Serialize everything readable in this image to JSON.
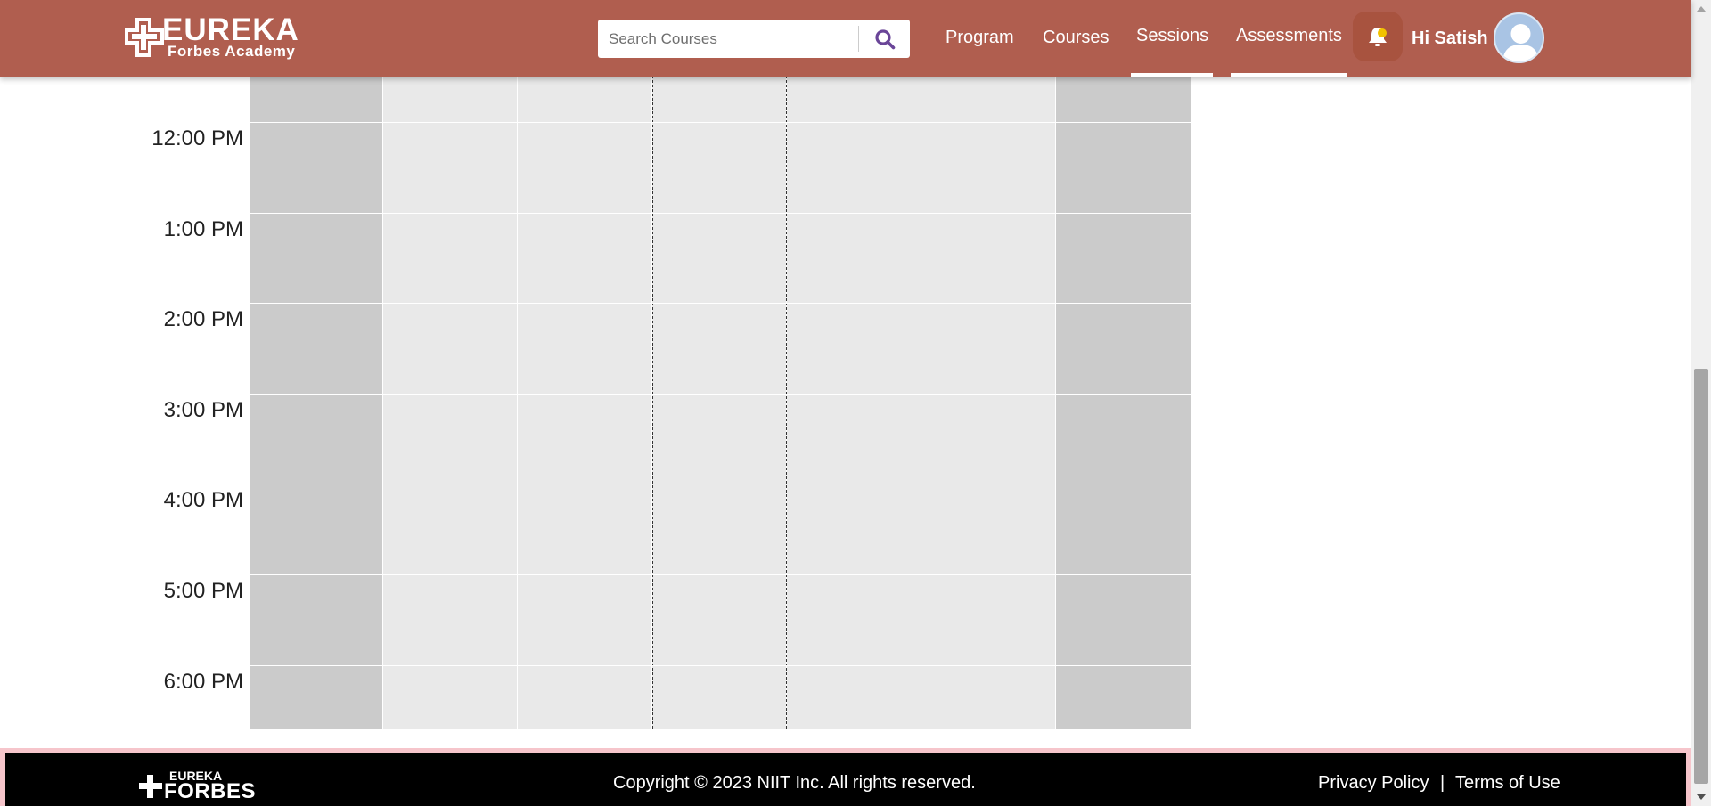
{
  "header": {
    "logo_line1": "EUREKA",
    "logo_line2": "Forbes Academy",
    "search_placeholder": "Search Courses",
    "nav": [
      {
        "label": "Program"
      },
      {
        "label": "Courses"
      },
      {
        "label": "Sessions"
      },
      {
        "label": "Assessments"
      }
    ],
    "greeting": "Hi Satish",
    "icons": {
      "search": "search-icon",
      "bell": "bell-icon",
      "avatar": "user-avatar-icon"
    }
  },
  "calendar": {
    "time_labels": [
      "12:00 PM",
      "1:00 PM",
      "2:00 PM",
      "3:00 PM",
      "4:00 PM",
      "5:00 PM",
      "6:00 PM"
    ],
    "day_columns": 7,
    "colors": {
      "weekend": "#cbcbcb",
      "weekday": "#e9e9e9"
    }
  },
  "footer": {
    "logo_line1": "EUREKA",
    "logo_line2": "FORBES",
    "copyright": "Copyright © 2023 NIIT Inc. All rights reserved.",
    "privacy": "Privacy Policy",
    "separator": "|",
    "terms": "Terms of Use"
  },
  "colors": {
    "header_bg": "#b05e4f",
    "search_icon": "#6a4598",
    "footer_bg": "#000000",
    "footer_border": "#f6c5cb"
  }
}
